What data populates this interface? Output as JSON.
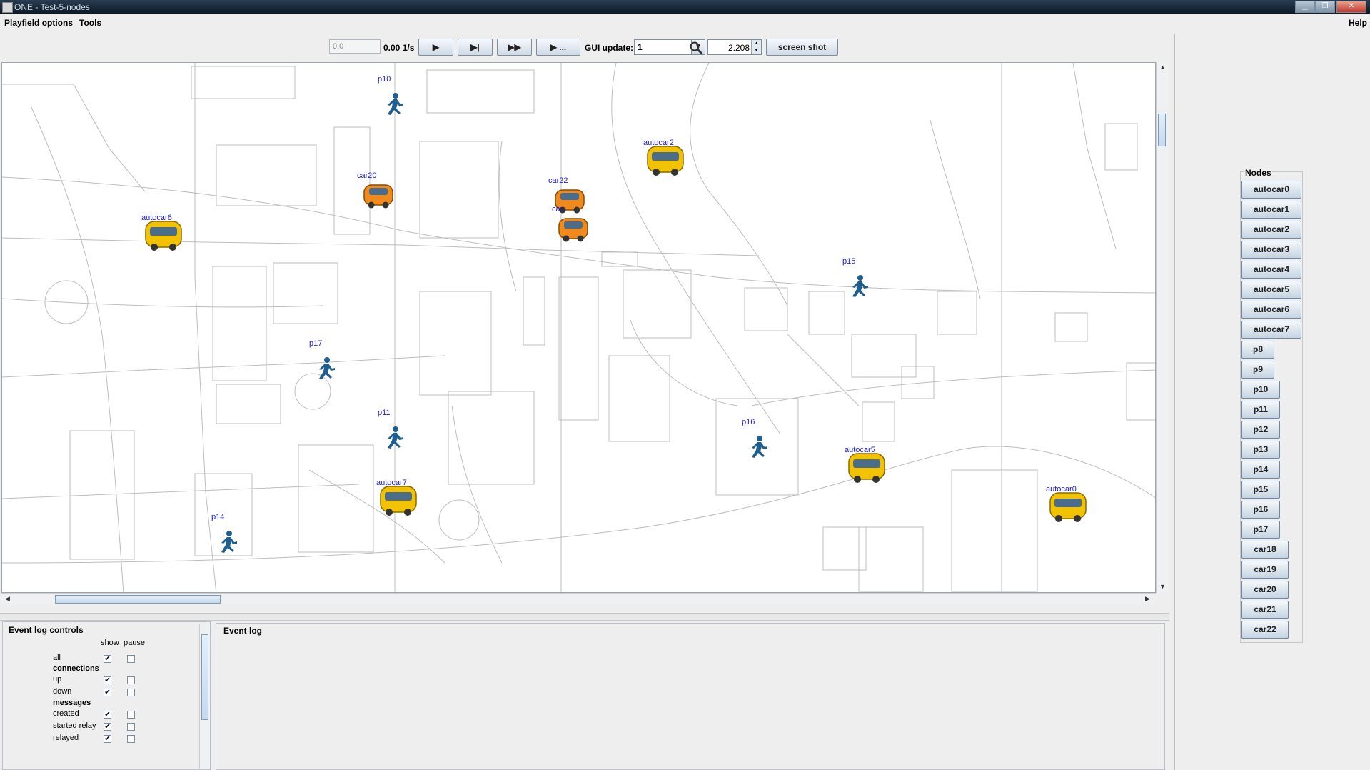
{
  "window": {
    "title": "ONE - Test-5-nodes"
  },
  "menubar": {
    "items": [
      "Playfield options",
      "Tools"
    ],
    "help": "Help"
  },
  "toolbar": {
    "sim_time": "0.0",
    "speed": "0.00 1/s",
    "gui_update_label": "GUI update:",
    "gui_update_value": "1",
    "zoom_value": "2.208",
    "screenshot_label": "screen shot",
    "play_label": "▶",
    "step_label": "▶|",
    "ffw_label": "▶▶",
    "play_until_label": "▶ ..."
  },
  "map_nodes": [
    {
      "id": "p10",
      "type": "person"
    },
    {
      "id": "autocar2",
      "type": "bus"
    },
    {
      "id": "car20",
      "type": "car"
    },
    {
      "id": "car22",
      "type": "car"
    },
    {
      "id": "car",
      "type": "car"
    },
    {
      "id": "autocar6",
      "type": "bus"
    },
    {
      "id": "p15",
      "type": "person"
    },
    {
      "id": "p17",
      "type": "person"
    },
    {
      "id": "p11",
      "type": "person"
    },
    {
      "id": "p16",
      "type": "person"
    },
    {
      "id": "autocar5",
      "type": "bus"
    },
    {
      "id": "autocar7",
      "type": "bus"
    },
    {
      "id": "autocar0",
      "type": "bus"
    },
    {
      "id": "p14",
      "type": "person"
    }
  ],
  "event_log_controls": {
    "heading": "Event log controls",
    "col_show": "show",
    "col_pause": "pause",
    "rows": [
      {
        "label": "all",
        "type": "item",
        "show": true,
        "pause": false
      },
      {
        "label": "connections",
        "type": "section"
      },
      {
        "label": "up",
        "type": "item",
        "show": true,
        "pause": false
      },
      {
        "label": "down",
        "type": "item",
        "show": true,
        "pause": false
      },
      {
        "label": "messages",
        "type": "section"
      },
      {
        "label": "created",
        "type": "item",
        "show": true,
        "pause": false
      },
      {
        "label": "started relay",
        "type": "item",
        "show": true,
        "pause": false
      },
      {
        "label": "relayed",
        "type": "item",
        "show": true,
        "pause": false
      }
    ]
  },
  "event_log": {
    "heading": "Event log"
  },
  "nodes_panel": {
    "heading": "Nodes",
    "items": [
      "autocar0",
      "autocar1",
      "autocar2",
      "autocar3",
      "autocar4",
      "autocar5",
      "autocar6",
      "autocar7",
      "p8",
      "p9",
      "p10",
      "p11",
      "p12",
      "p13",
      "p14",
      "p15",
      "p16",
      "p17",
      "car18",
      "car19",
      "car20",
      "car21",
      "car22"
    ]
  },
  "colors": {
    "node_label": "#1a1ad6",
    "person": "#1f5f8f",
    "bus": "#f2c200",
    "car": "#f08a1c"
  }
}
